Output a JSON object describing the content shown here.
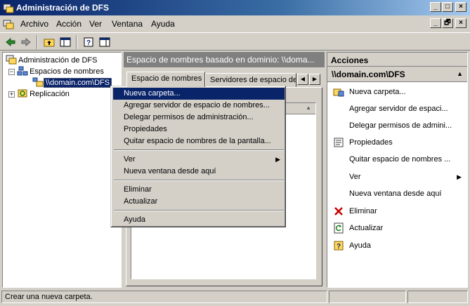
{
  "window": {
    "title": "Administración de DFS"
  },
  "caption_buttons": {
    "minimize": "_",
    "maximize": "□",
    "close": "×"
  },
  "mdi_buttons": {
    "minimize": "_",
    "restore": "🗗",
    "close": "×"
  },
  "menubar": {
    "items": [
      "Archivo",
      "Acción",
      "Ver",
      "Ventana",
      "Ayuda"
    ]
  },
  "tree": {
    "items": [
      {
        "label": "Administración de DFS",
        "icon": "dfs-root-icon"
      },
      {
        "label": "Espacios de nombres",
        "icon": "namespaces-icon",
        "expander": "−"
      },
      {
        "label": "\\\\domain.com\\DFS",
        "icon": "namespace-icon",
        "selected": true
      },
      {
        "label": "Replicación",
        "icon": "replication-icon",
        "expander": "+"
      }
    ]
  },
  "center": {
    "header": "Espacio de nombres basado en dominio: \\\\doma...",
    "tabs": [
      "Espacio de nombres",
      "Servidores de espacio de n"
    ],
    "tab_arrows": [
      "◀",
      "▶"
    ],
    "column_sort": "▲"
  },
  "actions": {
    "title": "Acciones",
    "subtitle": "\\\\domain.com\\DFS",
    "collapse_glyph": "▲",
    "submenu_glyph": "▶",
    "items": [
      {
        "label": "Nueva carpeta...",
        "icon": "new-folder-icon"
      },
      {
        "label": "Agregar servidor de espaci...",
        "icon": ""
      },
      {
        "label": "Delegar permisos de admini...",
        "icon": ""
      },
      {
        "label": "Propiedades",
        "icon": "properties-icon"
      },
      {
        "label": "Quitar espacio de nombres ...",
        "icon": ""
      },
      {
        "label": "Ver",
        "icon": "",
        "submenu": true
      },
      {
        "label": "Nueva ventana desde aquí",
        "icon": ""
      },
      {
        "label": "Eliminar",
        "icon": "delete-icon"
      },
      {
        "label": "Actualizar",
        "icon": "refresh-icon"
      },
      {
        "label": "Ayuda",
        "icon": "help-icon"
      }
    ]
  },
  "context_menu": {
    "submenu_glyph": "▶",
    "items": [
      {
        "label": "Nueva carpeta...",
        "highlighted": true
      },
      {
        "label": "Agregar servidor de espacio de nombres..."
      },
      {
        "label": "Delegar permisos de administración..."
      },
      {
        "label": "Propiedades"
      },
      {
        "label": "Quitar espacio de nombres de la pantalla..."
      },
      {
        "label": "Ver",
        "submenu": true
      },
      {
        "label": "Nueva ventana desde aquí"
      },
      {
        "label": "Eliminar"
      },
      {
        "label": "Actualizar"
      },
      {
        "label": "Ayuda"
      }
    ]
  },
  "status": {
    "text": "Crear una nueva carpeta."
  },
  "colors": {
    "titlebar": "#0a246a",
    "selection": "#0a246a",
    "face": "#d4d0c8",
    "delete": "#cc0000"
  }
}
